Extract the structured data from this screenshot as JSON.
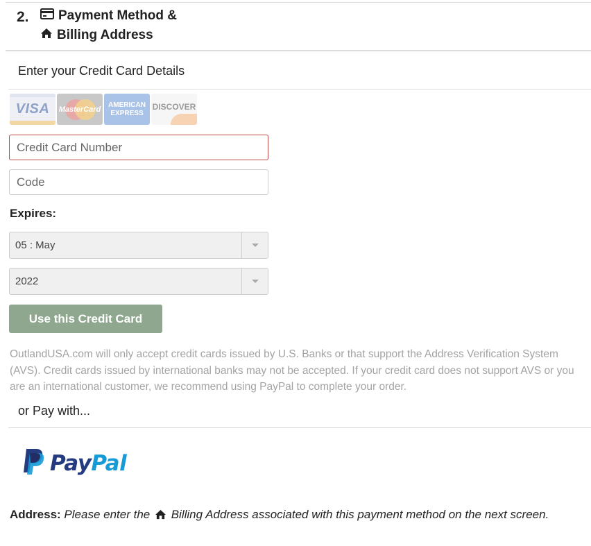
{
  "section": {
    "step_number": "2.",
    "title_line1": "Payment Method &",
    "title_line2": "Billing Address",
    "title_icon1": "credit-card-icon",
    "title_icon2": "home-icon"
  },
  "credit_card": {
    "heading": "Enter your Credit Card Details",
    "card_logos": [
      "VISA",
      "MasterCard",
      "AMERICAN EXPRESS",
      "DISCOVER"
    ],
    "number_placeholder": "Credit Card Number",
    "number_value": "",
    "code_placeholder": "Code",
    "code_value": "",
    "expires_label": "Expires:",
    "month_value": "05 : May",
    "year_value": "2022",
    "submit_label": "Use this Credit Card",
    "notice": "OutlandUSA.com will only accept credit cards issued by U.S. Banks or that support the Address Verification System (AVS). Credit cards issued by international banks may not be accepted. If your credit card does not support AVS or you are an international customer, we recommend using PayPal to complete your order."
  },
  "alternate": {
    "heading": "or Pay with...",
    "paypal_part1": "Pay",
    "paypal_part2": "Pal"
  },
  "address_note": {
    "label": "Address:",
    "text_before": "Please enter the",
    "text_after": "Billing Address associated with this payment method on the next screen."
  },
  "colors": {
    "error_border": "#b94a48",
    "button_bg": "#8fa68f",
    "paypal_dark": "#253b80",
    "paypal_light": "#179bd7"
  }
}
